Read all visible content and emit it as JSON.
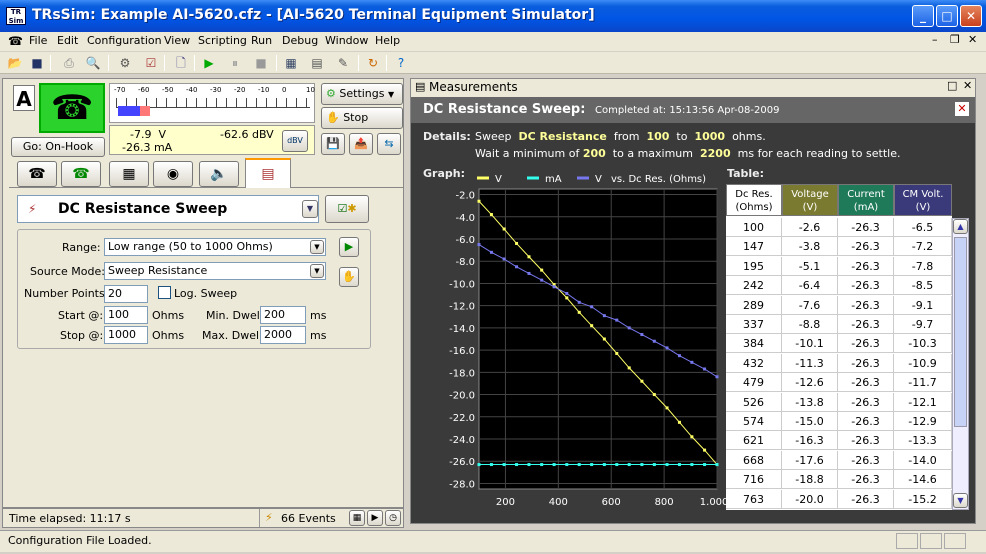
{
  "window": {
    "title": "TRsSim:  Example AI-5620.cfz - [AI-5620  Terminal Equipment Simulator]",
    "app_icon": "TR Sim"
  },
  "menu": [
    "File",
    "Edit",
    "Configuration",
    "View",
    "Scripting",
    "Run",
    "Debug",
    "Window",
    "Help"
  ],
  "left": {
    "channel": "A",
    "meter_ticks": [
      "-70",
      "-60",
      "-50",
      "-40",
      "-30",
      "-20",
      "-10",
      "0",
      "10"
    ],
    "readouts": {
      "volts": "-7.9  V",
      "ma": "-26.3 mA",
      "dbv": "-62.6 dBV",
      "unit_btn": "dBV"
    },
    "hook_button": "Go:  On-Hook",
    "settings_button": "Settings",
    "stop_button": "Stop",
    "function_title": "DC Resistance Sweep",
    "range_label": "Range:",
    "range_value": "Low range (50 to 1000 Ohms)",
    "source_label": "Source Mode:",
    "source_value": "Sweep Resistance",
    "points_label": "Number Points:",
    "points_value": "20",
    "log_label": "Log. Sweep",
    "start_label": "Start @:",
    "start_value": "100",
    "ohms1": "Ohms",
    "stop_label": "Stop @:",
    "stop_value": "1000",
    "ohms2": "Ohms",
    "mindwell_label": "Min. Dwell:",
    "mindwell_value": "200",
    "ms1": "ms",
    "maxdwell_label": "Max. Dwell:",
    "maxdwell_value": "2000",
    "ms2": "ms"
  },
  "status": {
    "elapsed": "Time elapsed:  11:17 s",
    "events": "66 Events",
    "message": "Configuration File Loaded."
  },
  "meas": {
    "title": "Measurements",
    "heading": "DC Resistance Sweep:",
    "completed": "Completed at:  15:13:56  Apr-08-2009",
    "details_label": "Details:",
    "d1": "Sweep",
    "d2": "DC Resistance",
    "d3": "from",
    "d4": "100",
    "d5": "to",
    "d6": "1000",
    "d7": "ohms.",
    "e1": "Wait a minimum of",
    "e2": "200",
    "e3": "to a maximum",
    "e4": "2200",
    "e5": "ms for each reading to settle.",
    "graph_label": "Graph:",
    "table_label": "Table:",
    "legend_vs": "vs.  Dc Res. (Ohms)",
    "columns": [
      {
        "l1": "Dc Res.",
        "l2": "(Ohms)",
        "bg": "#ffffff",
        "fg": "#000000"
      },
      {
        "l1": "Voltage",
        "l2": "(V)",
        "bg": "#7a7a30",
        "fg": "#ffffff"
      },
      {
        "l1": "Current",
        "l2": "(mA)",
        "bg": "#1f7a5a",
        "fg": "#ffffff"
      },
      {
        "l1": "CM Volt.",
        "l2": "(V)",
        "bg": "#3a3a7a",
        "fg": "#ffffff"
      }
    ],
    "rows": [
      [
        "100",
        "-2.6",
        "-26.3",
        "-6.5"
      ],
      [
        "147",
        "-3.8",
        "-26.3",
        "-7.2"
      ],
      [
        "195",
        "-5.1",
        "-26.3",
        "-7.8"
      ],
      [
        "242",
        "-6.4",
        "-26.3",
        "-8.5"
      ],
      [
        "289",
        "-7.6",
        "-26.3",
        "-9.1"
      ],
      [
        "337",
        "-8.8",
        "-26.3",
        "-9.7"
      ],
      [
        "384",
        "-10.1",
        "-26.3",
        "-10.3"
      ],
      [
        "432",
        "-11.3",
        "-26.3",
        "-10.9"
      ],
      [
        "479",
        "-12.6",
        "-26.3",
        "-11.7"
      ],
      [
        "526",
        "-13.8",
        "-26.3",
        "-12.1"
      ],
      [
        "574",
        "-15.0",
        "-26.3",
        "-12.9"
      ],
      [
        "621",
        "-16.3",
        "-26.3",
        "-13.3"
      ],
      [
        "668",
        "-17.6",
        "-26.3",
        "-14.0"
      ],
      [
        "716",
        "-18.8",
        "-26.3",
        "-14.6"
      ],
      [
        "763",
        "-20.0",
        "-26.3",
        "-15.2"
      ]
    ]
  },
  "chart_data": {
    "type": "line",
    "x": [
      100,
      147,
      195,
      242,
      289,
      337,
      384,
      432,
      479,
      526,
      574,
      621,
      668,
      716,
      763,
      811,
      858,
      905,
      953,
      1000
    ],
    "series": [
      {
        "name": "V",
        "color": "#ffff66",
        "values": [
          -2.6,
          -3.8,
          -5.1,
          -6.4,
          -7.6,
          -8.8,
          -10.1,
          -11.3,
          -12.6,
          -13.8,
          -15.0,
          -16.3,
          -17.6,
          -18.8,
          -20.0,
          -21.2,
          -22.5,
          -23.8,
          -25.0,
          -26.3
        ]
      },
      {
        "name": "mA",
        "color": "#33ffee",
        "values": [
          -26.3,
          -26.3,
          -26.3,
          -26.3,
          -26.3,
          -26.3,
          -26.3,
          -26.3,
          -26.3,
          -26.3,
          -26.3,
          -26.3,
          -26.3,
          -26.3,
          -26.3,
          -26.3,
          -26.3,
          -26.3,
          -26.3,
          -26.3
        ]
      },
      {
        "name": "V",
        "color": "#7777ee",
        "values": [
          -6.5,
          -7.2,
          -7.8,
          -8.5,
          -9.1,
          -9.7,
          -10.3,
          -10.9,
          -11.7,
          -12.1,
          -12.9,
          -13.3,
          -14.0,
          -14.6,
          -15.2,
          -15.8,
          -16.5,
          -17.1,
          -17.7,
          -18.4
        ]
      }
    ],
    "xlim": [
      100,
      1000
    ],
    "ylim": [
      -28.5,
      -1.5
    ],
    "yticks": [
      "-2.0",
      "-4.0",
      "-6.0",
      "-8.0",
      "-10.0",
      "-12.0",
      "-14.0",
      "-16.0",
      "-18.0",
      "-20.0",
      "-22.0",
      "-24.0",
      "-26.0",
      "-28.0"
    ],
    "xticks": [
      "200",
      "400",
      "600",
      "800",
      "1.000k"
    ],
    "grid": true,
    "legend": "top"
  }
}
